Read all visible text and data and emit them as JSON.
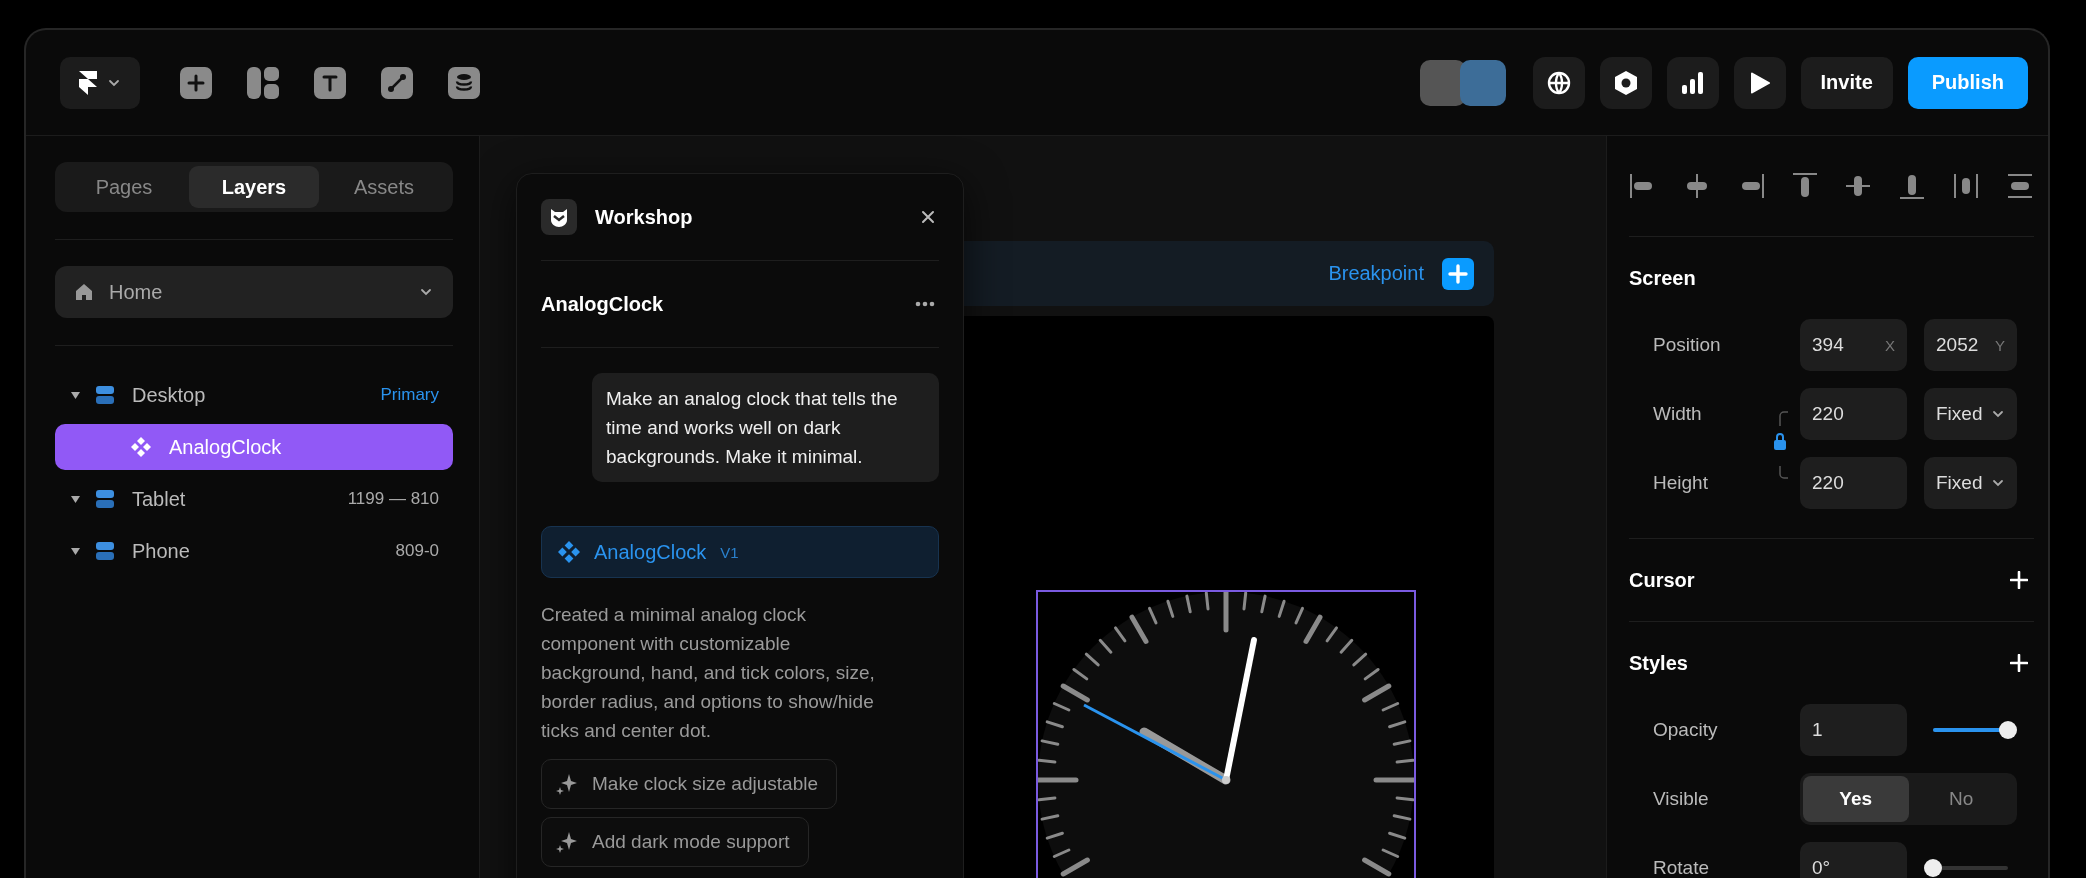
{
  "toolbar": {
    "buttons": [
      {
        "label": "Invite",
        "kind": "secondary"
      },
      {
        "label": "Publish",
        "kind": "primary"
      }
    ]
  },
  "left_panel": {
    "tabs": [
      {
        "label": "Pages",
        "selected": false
      },
      {
        "label": "Layers",
        "selected": true
      },
      {
        "label": "Assets",
        "selected": false
      }
    ],
    "page_select": {
      "value": "Home"
    },
    "layers": [
      {
        "label": "Desktop",
        "note": "Primary",
        "note_accent": true,
        "selected": false,
        "children": [
          {
            "label": "AnalogClock",
            "selected": true
          }
        ]
      },
      {
        "label": "Tablet",
        "note": "1199 — 810",
        "note_accent": false,
        "selected": false
      },
      {
        "label": "Phone",
        "note": "809-0",
        "note_accent": false,
        "selected": false
      }
    ]
  },
  "workshop": {
    "title": "Workshop",
    "component": "AnalogClock",
    "prompt": "Make an analog clock that tells the time and works well on dark backgrounds. Make it minimal.",
    "result": {
      "name": "AnalogClock",
      "version": "V1"
    },
    "summary": "Created a minimal analog clock component with customizable background, hand, and tick colors, size, border radius, and options to show/hide ticks and center dot.",
    "suggestions": [
      "Make clock size adjustable",
      "Add dark mode support"
    ]
  },
  "canvas": {
    "breakpoint_button": "Breakpoint"
  },
  "properties": {
    "sections": [
      {
        "title": "Screen",
        "rows": [
          {
            "kind": "pair",
            "label": "Position",
            "fields": [
              {
                "value": "394",
                "unit": "X"
              },
              {
                "value": "2052",
                "unit": "Y"
              }
            ]
          },
          {
            "kind": "size",
            "label": "Width",
            "value": "220",
            "mode": "Fixed"
          },
          {
            "kind": "size",
            "label": "Height",
            "value": "220",
            "mode": "Fixed"
          }
        ]
      },
      {
        "title": "Cursor"
      },
      {
        "title": "Styles",
        "rows": [
          {
            "kind": "slider",
            "label": "Opacity",
            "value": "1",
            "level": 1
          },
          {
            "kind": "segmented",
            "label": "Visible",
            "options": [
              {
                "label": "Yes",
                "selected": true
              },
              {
                "label": "No",
                "selected": false
              }
            ]
          },
          {
            "kind": "slider",
            "label": "Rotate",
            "value": "0°",
            "level": 0
          }
        ]
      }
    ]
  }
}
